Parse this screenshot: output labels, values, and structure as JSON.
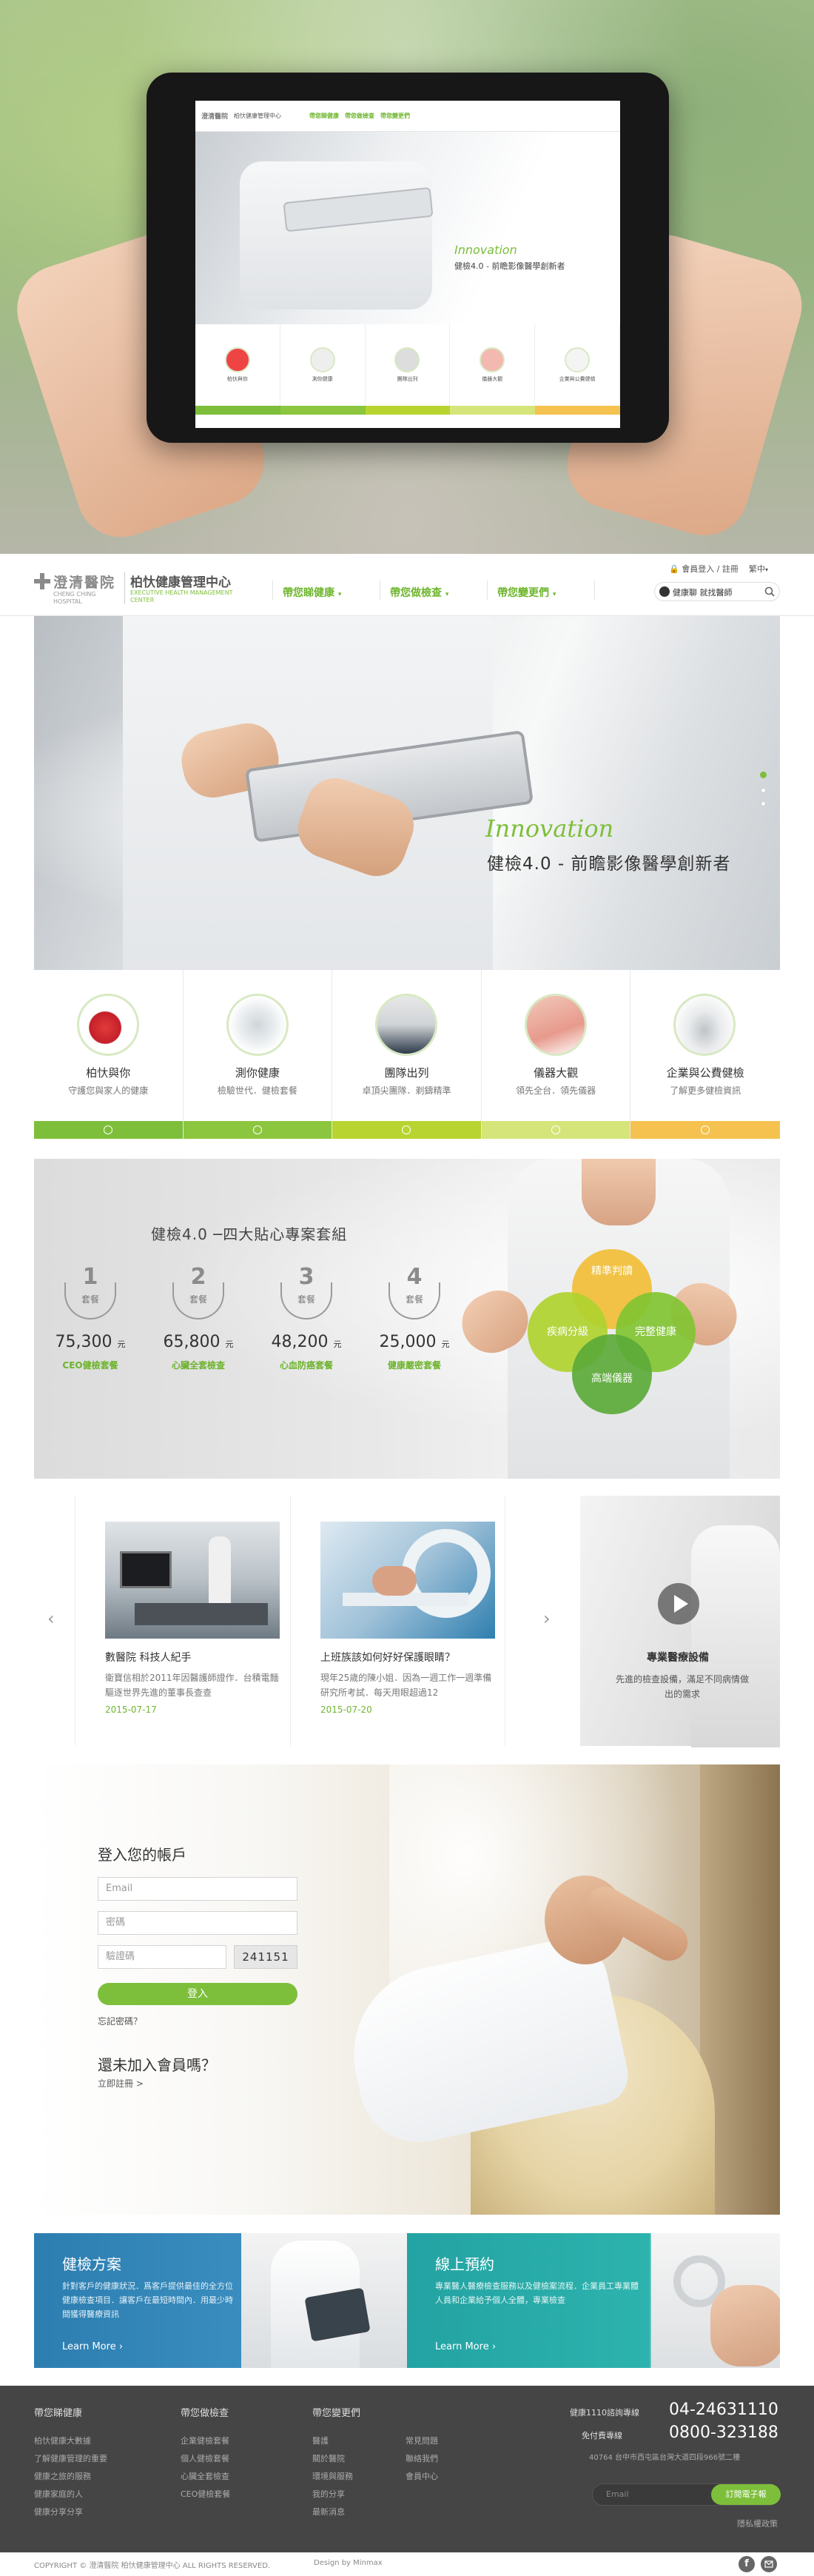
{
  "brand": {
    "name_cn": "澄清醫院",
    "name_en": "CHENG CHING HOSPITAL",
    "center_cn": "柏忕健康管理中心",
    "center_en": "EXECUTIVE HEALTH MANAGEMENT CENTER"
  },
  "nav": {
    "items": [
      "帶您睇健康",
      "帶您做檢查",
      "帶您變更們"
    ],
    "login": "會員登入 / 註冊",
    "lang": "繁中",
    "search_value": "健康聊 就找醫師"
  },
  "hero": {
    "eyebrow": "Innovation",
    "headline": "健檢4.0 - 前瞻影像醫學創新者"
  },
  "cards": [
    {
      "title": "柏忕與你",
      "desc": "守護您與家人的健康",
      "icon": "heart-icon",
      "color": "#7dbf3a"
    },
    {
      "title": "測你健康",
      "desc": "檢驗世代．健檢套餐",
      "icon": "stethoscope-icon",
      "color": "#8cc63f"
    },
    {
      "title": "團隊出列",
      "desc": "卓頂尖團隊．剃鑄精準",
      "icon": "team-icon",
      "color": "#b8d430"
    },
    {
      "title": "儀器大觀",
      "desc": "領先全台．領先儀器",
      "icon": "device-icon",
      "color": "#d5e57a"
    },
    {
      "title": "企業與公費健檢",
      "desc": "了解更多健檢資訊",
      "icon": "corporate-icon",
      "color": "#f5c24f"
    }
  ],
  "packages": {
    "title": "健檢4.0 ─四大貼心專案套組",
    "unit_label": "套餐",
    "currency": "元",
    "items": [
      {
        "num": "1",
        "price": "75,300",
        "name": "CEO健檢套餐"
      },
      {
        "num": "2",
        "price": "65,800",
        "name": "心臟全套檢查"
      },
      {
        "num": "3",
        "price": "48,200",
        "name": "心血防癌套餐"
      },
      {
        "num": "4",
        "price": "25,000",
        "name": "健康嚴密套餐"
      }
    ],
    "bubbles": [
      "精準判讀",
      "疾病分級",
      "完整健康",
      "高端儀器"
    ]
  },
  "news": {
    "items": [
      {
        "title": "數醫院 科技人紀手",
        "desc": "衛寶信相於2011年因醫護師證作．台積電麵驅逐世界先進的董事長查查",
        "date": "2015-07-17"
      },
      {
        "title": "上班族該如何好好保護眼睛？",
        "desc": "現年25歲的陳小姐．因為一週工作一週準備研究所考試．每天用眼超過12",
        "date": "2015-07-20"
      }
    ],
    "video": {
      "title": "專業醫療設備",
      "desc": "先進的檢查設備，滿足不同病情做出的需求"
    }
  },
  "login": {
    "title": "登入您的帳戶",
    "email_ph": "Email",
    "password_ph": "密碼",
    "captcha_ph": "驗證碼",
    "captcha_code": "241151",
    "submit": "登入",
    "forgot": "忘記密碼？",
    "not_member": "還未加入會員嗎？",
    "register": "立即註冊 >"
  },
  "promos": [
    {
      "title": "健檢方案",
      "desc": "針對客戶的健康狀況．爲客戶提供最佳的全方位健康檢查項目．讓客戶在最短時間內．用最少時間獲得醫療資訊",
      "link": "Learn More"
    },
    {
      "title": "線上預約",
      "desc": "專業醫人醫療檢查服務以及健檢案流程．企業員工專業體人員和企業給予個人全體，專業檢查",
      "link": "Learn More"
    }
  ],
  "footer": {
    "cols": [
      {
        "h": "帶您睇健康",
        "links": [
          "柏忕健康大數據",
          "了解健康管理的重要",
          "健康之旅的服務",
          "健康家庭的人",
          "健康分享分享"
        ]
      },
      {
        "h": "帶您做檢查",
        "links": [
          "企業健檢套餐",
          "個人健檢套餐",
          "心臟全套檢查",
          "CEO健檢套餐"
        ]
      },
      {
        "h": "帶您變更們",
        "links": [
          "醫護",
          "關於醫院",
          "環境與服務",
          "我的分享",
          "最新消息"
        ]
      },
      {
        "h": "",
        "links": [
          "常見問題",
          "聯絡我們",
          "會員中心"
        ]
      }
    ],
    "hotline_label": "健康1110諮詢專線",
    "hotline": "04-24631110",
    "tollfree_label": "免付費專線",
    "tollfree": "0800-323188",
    "address": "40764 台中市西屯區台灣大道四段966號二樓",
    "newsletter_ph": "Email",
    "newsletter_btn": "訂閱電子報",
    "privacy": "隱私權政策",
    "copyright": "COPYRIGHT © 澄清醫院 柏忕健康管理中心 ALL RIGHTS RESERVED.",
    "design": "Design by Minmax"
  }
}
